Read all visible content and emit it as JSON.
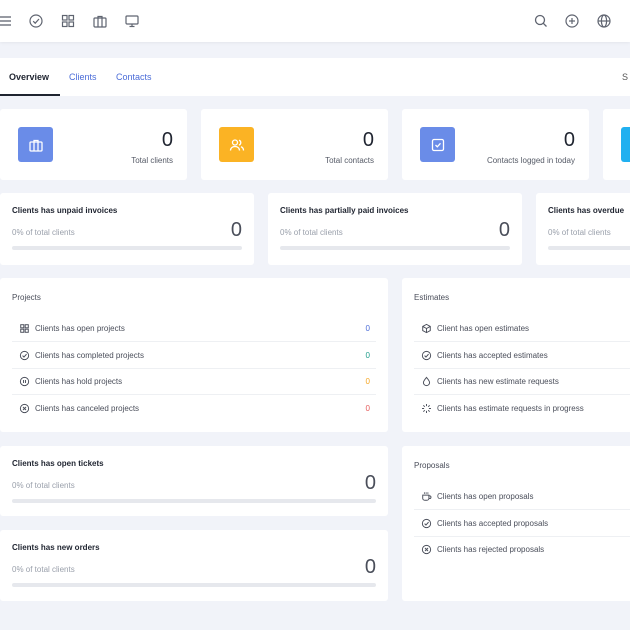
{
  "topbar": {
    "left_icons": [
      "menu-icon",
      "check-circle-icon",
      "grid-icon",
      "briefcase-icon",
      "monitor-icon"
    ],
    "right_icons": [
      "search-icon",
      "plus-circle-icon",
      "globe-icon"
    ]
  },
  "tabs": [
    {
      "label": "Overview",
      "active": true
    },
    {
      "label": "Clients",
      "active": false
    },
    {
      "label": "Contacts",
      "active": false
    }
  ],
  "tab_edge": "S",
  "stats": [
    {
      "value": "0",
      "label": "Total clients",
      "color": "#6a8ce8",
      "icon": "briefcase-icon"
    },
    {
      "value": "0",
      "label": "Total contacts",
      "color": "#fbb324",
      "icon": "users-icon"
    },
    {
      "value": "0",
      "label": "Contacts logged in today",
      "color": "#6a8ce8",
      "icon": "check-square-icon"
    },
    {
      "color": "#21b0f0"
    }
  ],
  "payment_cards": [
    {
      "title": "Clients has unpaid invoices",
      "sub": "0% of total clients",
      "value": "0",
      "progress": 0
    },
    {
      "title": "Clients has partially paid invoices",
      "sub": "0% of total clients",
      "value": "0",
      "progress": 0
    },
    {
      "title": "Clients has overdue",
      "sub": "0% of total clients",
      "value": "",
      "progress": 0
    }
  ],
  "projects": {
    "title": "Projects",
    "rows": [
      {
        "label": "Clients has open projects",
        "value": "0",
        "color": "#4b6cd8",
        "icon": "grid-icon"
      },
      {
        "label": "Clients has completed projects",
        "value": "0",
        "color": "#1f9d8b",
        "icon": "check-circle-icon"
      },
      {
        "label": "Clients has hold projects",
        "value": "0",
        "color": "#f5a623",
        "icon": "pause-circle-icon"
      },
      {
        "label": "Clients has canceled projects",
        "value": "0",
        "color": "#e55b5b",
        "icon": "x-circle-icon"
      }
    ]
  },
  "estimates": {
    "title": "Estimates",
    "rows": [
      {
        "label": "Client has open estimates",
        "icon": "box-icon"
      },
      {
        "label": "Clients has accepted estimates",
        "icon": "check-circle-icon"
      },
      {
        "label": "Clients has new estimate requests",
        "icon": "droplet-icon"
      },
      {
        "label": "Clients has estimate requests in progress",
        "icon": "loader-icon"
      }
    ]
  },
  "tickets": {
    "title": "Clients has open tickets",
    "sub": "0% of total clients",
    "value": "0",
    "progress": 0
  },
  "orders": {
    "title": "Clients has new orders",
    "sub": "0% of total clients",
    "value": "0",
    "progress": 0
  },
  "proposals": {
    "title": "Proposals",
    "rows": [
      {
        "label": "Clients has open proposals",
        "icon": "coffee-icon"
      },
      {
        "label": "Clients has accepted proposals",
        "icon": "check-circle-icon"
      },
      {
        "label": "Clients has rejected proposals",
        "icon": "x-circle-icon"
      }
    ]
  }
}
